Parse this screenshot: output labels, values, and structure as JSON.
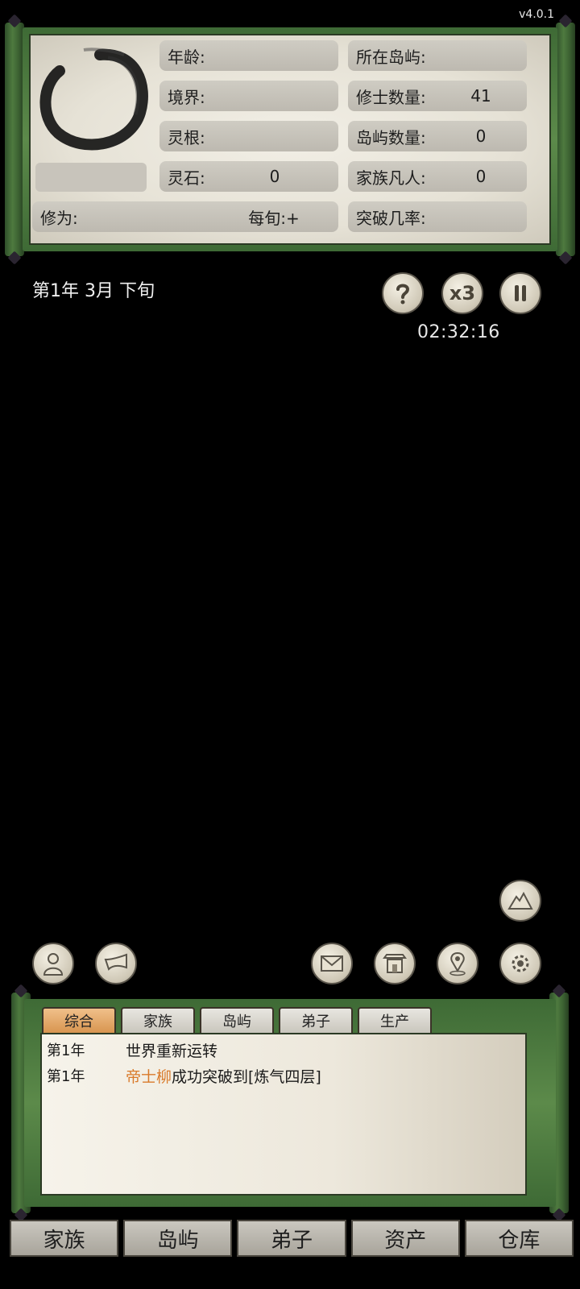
{
  "version": "v4.0.1",
  "stats": {
    "age_label": "年龄:",
    "island_label": "所在岛屿:",
    "realm_label": "境界:",
    "cultivators_label": "修士数量:",
    "cultivators_value": "41",
    "root_label": "灵根:",
    "island_count_label": "岛屿数量:",
    "island_count_value": "0",
    "stones_label": "灵石:",
    "stones_value": "0",
    "mortals_label": "家族凡人:",
    "mortals_value": "0",
    "cultivation_label": "修为:",
    "per_period_label": "每旬:+",
    "breakthrough_label": "突破几率:"
  },
  "status": {
    "date": "第1年 3月 下旬",
    "timer": "02:32:16",
    "speed_label": "x3"
  },
  "icons": {
    "help": "question-icon",
    "speed": "speed-x3-icon",
    "pause": "pause-icon",
    "mountain": "mountain-icon",
    "character": "character-icon",
    "horn": "horn-icon",
    "mail": "mail-icon",
    "shrine": "shrine-icon",
    "map_pin": "map-pin-icon",
    "settings": "gear-icon"
  },
  "log": {
    "tabs": [
      "综合",
      "家族",
      "岛屿",
      "弟子",
      "生产"
    ],
    "active_tab": "综合",
    "entries": [
      {
        "year": "第1年",
        "text": "世界重新运转"
      },
      {
        "year": "第1年",
        "name": "帝士柳",
        "text": "成功突破到[炼气四层]"
      }
    ]
  },
  "nav": [
    "家族",
    "岛屿",
    "弟子",
    "资产",
    "仓库"
  ],
  "colors": {
    "background": "#000000",
    "scroll_green": "#4e7a3f",
    "paper": "#ece8dd",
    "highlight_name": "#d97a2a",
    "active_tab": "#e8a96a"
  }
}
